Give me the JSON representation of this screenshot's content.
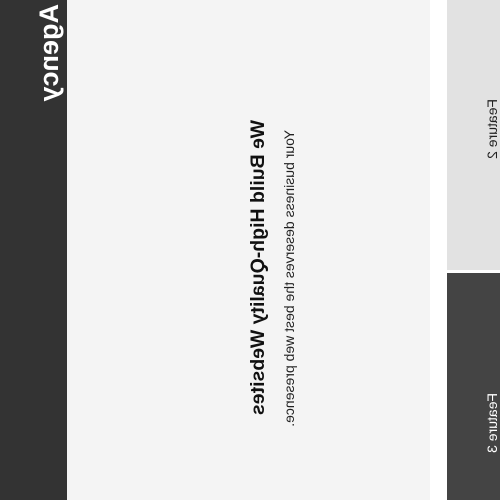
{
  "brand": {
    "name": "Agency",
    "strip_color": "#333333"
  },
  "hero": {
    "title": "We Build High-Quality Websites",
    "subtitle": "Your business deserves the best web presence.",
    "background": "#f4f4f4"
  },
  "features": [
    {
      "label": "Feature 2",
      "background": "#e2e2e2",
      "text_color": "#222222"
    },
    {
      "label": "Feature 3",
      "background": "#444444",
      "text_color": "#ffffff"
    }
  ]
}
